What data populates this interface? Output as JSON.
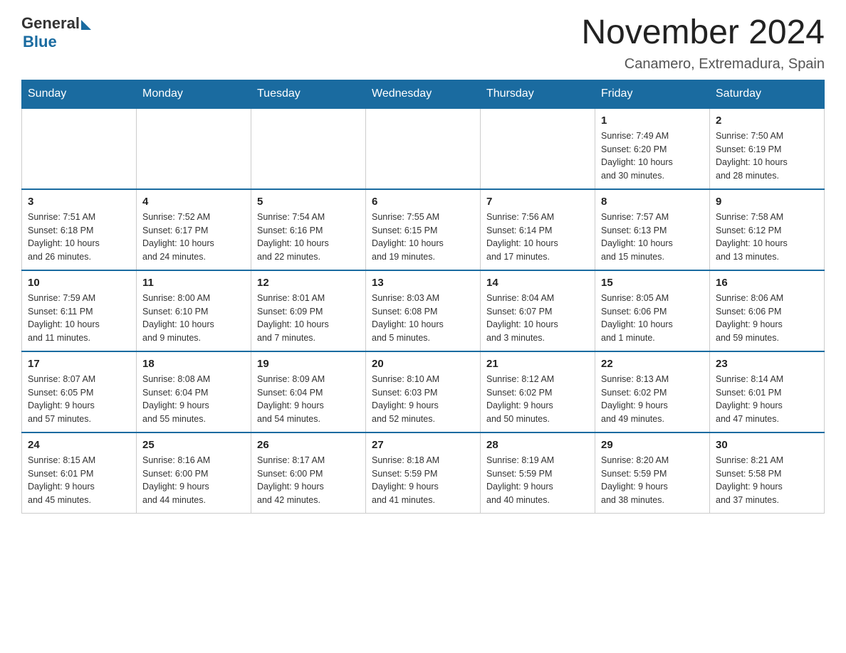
{
  "logo": {
    "general_text": "General",
    "blue_text": "Blue"
  },
  "title": "November 2024",
  "subtitle": "Canamero, Extremadura, Spain",
  "weekdays": [
    "Sunday",
    "Monday",
    "Tuesday",
    "Wednesday",
    "Thursday",
    "Friday",
    "Saturday"
  ],
  "weeks": [
    [
      {
        "day": "",
        "info": ""
      },
      {
        "day": "",
        "info": ""
      },
      {
        "day": "",
        "info": ""
      },
      {
        "day": "",
        "info": ""
      },
      {
        "day": "",
        "info": ""
      },
      {
        "day": "1",
        "info": "Sunrise: 7:49 AM\nSunset: 6:20 PM\nDaylight: 10 hours\nand 30 minutes."
      },
      {
        "day": "2",
        "info": "Sunrise: 7:50 AM\nSunset: 6:19 PM\nDaylight: 10 hours\nand 28 minutes."
      }
    ],
    [
      {
        "day": "3",
        "info": "Sunrise: 7:51 AM\nSunset: 6:18 PM\nDaylight: 10 hours\nand 26 minutes."
      },
      {
        "day": "4",
        "info": "Sunrise: 7:52 AM\nSunset: 6:17 PM\nDaylight: 10 hours\nand 24 minutes."
      },
      {
        "day": "5",
        "info": "Sunrise: 7:54 AM\nSunset: 6:16 PM\nDaylight: 10 hours\nand 22 minutes."
      },
      {
        "day": "6",
        "info": "Sunrise: 7:55 AM\nSunset: 6:15 PM\nDaylight: 10 hours\nand 19 minutes."
      },
      {
        "day": "7",
        "info": "Sunrise: 7:56 AM\nSunset: 6:14 PM\nDaylight: 10 hours\nand 17 minutes."
      },
      {
        "day": "8",
        "info": "Sunrise: 7:57 AM\nSunset: 6:13 PM\nDaylight: 10 hours\nand 15 minutes."
      },
      {
        "day": "9",
        "info": "Sunrise: 7:58 AM\nSunset: 6:12 PM\nDaylight: 10 hours\nand 13 minutes."
      }
    ],
    [
      {
        "day": "10",
        "info": "Sunrise: 7:59 AM\nSunset: 6:11 PM\nDaylight: 10 hours\nand 11 minutes."
      },
      {
        "day": "11",
        "info": "Sunrise: 8:00 AM\nSunset: 6:10 PM\nDaylight: 10 hours\nand 9 minutes."
      },
      {
        "day": "12",
        "info": "Sunrise: 8:01 AM\nSunset: 6:09 PM\nDaylight: 10 hours\nand 7 minutes."
      },
      {
        "day": "13",
        "info": "Sunrise: 8:03 AM\nSunset: 6:08 PM\nDaylight: 10 hours\nand 5 minutes."
      },
      {
        "day": "14",
        "info": "Sunrise: 8:04 AM\nSunset: 6:07 PM\nDaylight: 10 hours\nand 3 minutes."
      },
      {
        "day": "15",
        "info": "Sunrise: 8:05 AM\nSunset: 6:06 PM\nDaylight: 10 hours\nand 1 minute."
      },
      {
        "day": "16",
        "info": "Sunrise: 8:06 AM\nSunset: 6:06 PM\nDaylight: 9 hours\nand 59 minutes."
      }
    ],
    [
      {
        "day": "17",
        "info": "Sunrise: 8:07 AM\nSunset: 6:05 PM\nDaylight: 9 hours\nand 57 minutes."
      },
      {
        "day": "18",
        "info": "Sunrise: 8:08 AM\nSunset: 6:04 PM\nDaylight: 9 hours\nand 55 minutes."
      },
      {
        "day": "19",
        "info": "Sunrise: 8:09 AM\nSunset: 6:04 PM\nDaylight: 9 hours\nand 54 minutes."
      },
      {
        "day": "20",
        "info": "Sunrise: 8:10 AM\nSunset: 6:03 PM\nDaylight: 9 hours\nand 52 minutes."
      },
      {
        "day": "21",
        "info": "Sunrise: 8:12 AM\nSunset: 6:02 PM\nDaylight: 9 hours\nand 50 minutes."
      },
      {
        "day": "22",
        "info": "Sunrise: 8:13 AM\nSunset: 6:02 PM\nDaylight: 9 hours\nand 49 minutes."
      },
      {
        "day": "23",
        "info": "Sunrise: 8:14 AM\nSunset: 6:01 PM\nDaylight: 9 hours\nand 47 minutes."
      }
    ],
    [
      {
        "day": "24",
        "info": "Sunrise: 8:15 AM\nSunset: 6:01 PM\nDaylight: 9 hours\nand 45 minutes."
      },
      {
        "day": "25",
        "info": "Sunrise: 8:16 AM\nSunset: 6:00 PM\nDaylight: 9 hours\nand 44 minutes."
      },
      {
        "day": "26",
        "info": "Sunrise: 8:17 AM\nSunset: 6:00 PM\nDaylight: 9 hours\nand 42 minutes."
      },
      {
        "day": "27",
        "info": "Sunrise: 8:18 AM\nSunset: 5:59 PM\nDaylight: 9 hours\nand 41 minutes."
      },
      {
        "day": "28",
        "info": "Sunrise: 8:19 AM\nSunset: 5:59 PM\nDaylight: 9 hours\nand 40 minutes."
      },
      {
        "day": "29",
        "info": "Sunrise: 8:20 AM\nSunset: 5:59 PM\nDaylight: 9 hours\nand 38 minutes."
      },
      {
        "day": "30",
        "info": "Sunrise: 8:21 AM\nSunset: 5:58 PM\nDaylight: 9 hours\nand 37 minutes."
      }
    ]
  ]
}
